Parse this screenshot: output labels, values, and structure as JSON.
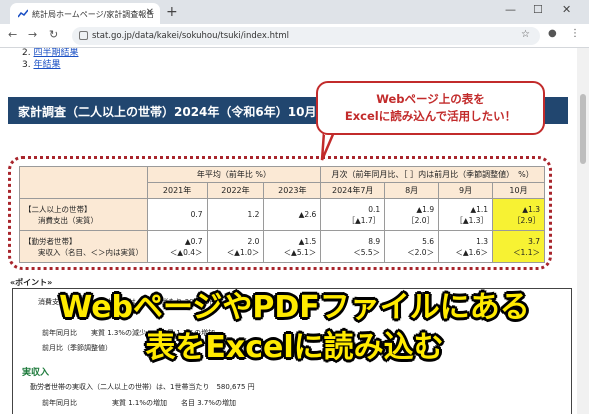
{
  "browser": {
    "tab_title": "統計局ホームページ/家計調査報告",
    "tab_close": "✕",
    "new_tab": "+",
    "url": "stat.go.jp/data/kakei/sokuhou/tsuki/index.html",
    "window_minimize": "—",
    "window_maximize": "☐",
    "window_close": "✕"
  },
  "toc": {
    "item2_num": "2.",
    "item2_label": "四半期結果",
    "item3_num": "3.",
    "item3_label": "年結果"
  },
  "banner": {
    "title": "家計調査（二人以上の世帯）2024年（令和6年）10月分"
  },
  "callout": {
    "line1": "Webページ上の表を",
    "line2": "Excelに読み込んで活用したい！"
  },
  "table": {
    "group_annual": "年平均（前年比 %）",
    "group_monthly": "月次（前年同月比、［ ］内は前月比（季節調整値）　%）",
    "years": [
      "2021年",
      "2022年",
      "2023年"
    ],
    "months": [
      "2024年7月",
      "8月",
      "9月",
      "10月"
    ],
    "row1_label_a": "【二人以上の世帯】",
    "row1_label_b": "消費支出（実質）",
    "row1_annual": [
      "0.7",
      "1.2",
      "▲2.6"
    ],
    "row1_monthly_main": [
      "0.1",
      "▲1.9",
      "▲1.1",
      "▲1.3"
    ],
    "row1_monthly_sub": [
      "［▲1.7］",
      "［2.0］",
      "［▲1.3］",
      "［2.9］"
    ],
    "row2_label_a": "【勤労者世帯】",
    "row2_label_b": "実収入（名目、＜＞内は実質）",
    "row2_annual_main": [
      "▲0.7",
      "2.0",
      "▲1.5"
    ],
    "row2_annual_sub": [
      "＜▲0.4＞",
      "＜▲1.0＞",
      "＜▲5.1＞"
    ],
    "row2_monthly_main": [
      "8.9",
      "5.6",
      "1.3",
      "3.7"
    ],
    "row2_monthly_sub": [
      "＜5.5＞",
      "＜2.0＞",
      "＜▲1.6＞",
      "＜1.1＞"
    ]
  },
  "points": {
    "heading": "«ポイント»",
    "line1": "消費支出（二人以上の世帯）は、1世帯当たり 30…19円",
    "line2": "前年同月比　　実質 1.3%の減少　　名目 1.3%の増加",
    "line3": "前月比（季節調整値）",
    "section": "実収入",
    "line4": "勤労者世帯の実収入（二人以上の世帯）は、1世帯当たり　580,675 円",
    "line5": "前年同月比　　　　　実質 1.1%の増加　　名目 3.7%の増加"
  },
  "headline": {
    "line1": "WebページやPDFファイルにある",
    "line2": "表をExcelに読み込む"
  },
  "colors": {
    "banner": "#21466f",
    "accent_red": "#c22b2b",
    "headline_yellow": "#ffea00",
    "highlight": "#f7f233",
    "header_fill": "#fbe9d5"
  }
}
